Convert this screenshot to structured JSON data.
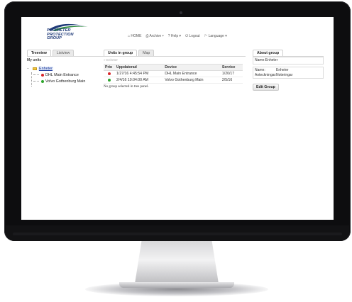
{
  "logo": {
    "line1": "PERIMETER",
    "line2": "PROTECTION",
    "line3": "GROUP"
  },
  "topnav": {
    "home": "⌂ HOME",
    "archive": "⎙ Archive ▾",
    "help": "? Help ▾",
    "logout": "⏻ Logout",
    "language": "⚐ Language ▾"
  },
  "left_panel": {
    "tabs": [
      "Treeview",
      "Listview"
    ],
    "title": "My units",
    "tree": {
      "expander": "−",
      "root": "Enheter",
      "children": [
        {
          "label": "DHL Main Entrance",
          "status_color": "#d8272b"
        },
        {
          "label": "Volvo Gothenburg Main",
          "status_color": "#2fa52e"
        }
      ]
    }
  },
  "center_panel": {
    "tabs": [
      "Units in group",
      "Map"
    ],
    "breadcrumb": "» Enheter",
    "columns": [
      "Prio",
      "Uppdaterad",
      "Device",
      "Service"
    ],
    "rows": [
      {
        "prio_color": "#d8272b",
        "updated": "1/27/16 4:45:54 PM",
        "device": "DHL Main Entrance",
        "service": "1/20/17"
      },
      {
        "prio_color": "#2fa52e",
        "updated": "2/4/16 10:04:00 AM",
        "device": "Volvo Gothenburg Main",
        "service": "2/5/16"
      }
    ],
    "status_message": "No group selected in tree panel."
  },
  "right_panel": {
    "tab": "About group",
    "name_line": "Namn:Enheter",
    "fields": [
      {
        "label": "Namn:",
        "value": "Enheter"
      },
      {
        "label": "Anteckningar:",
        "value": "Noteringar"
      }
    ],
    "edit_button": "Edit Group"
  }
}
